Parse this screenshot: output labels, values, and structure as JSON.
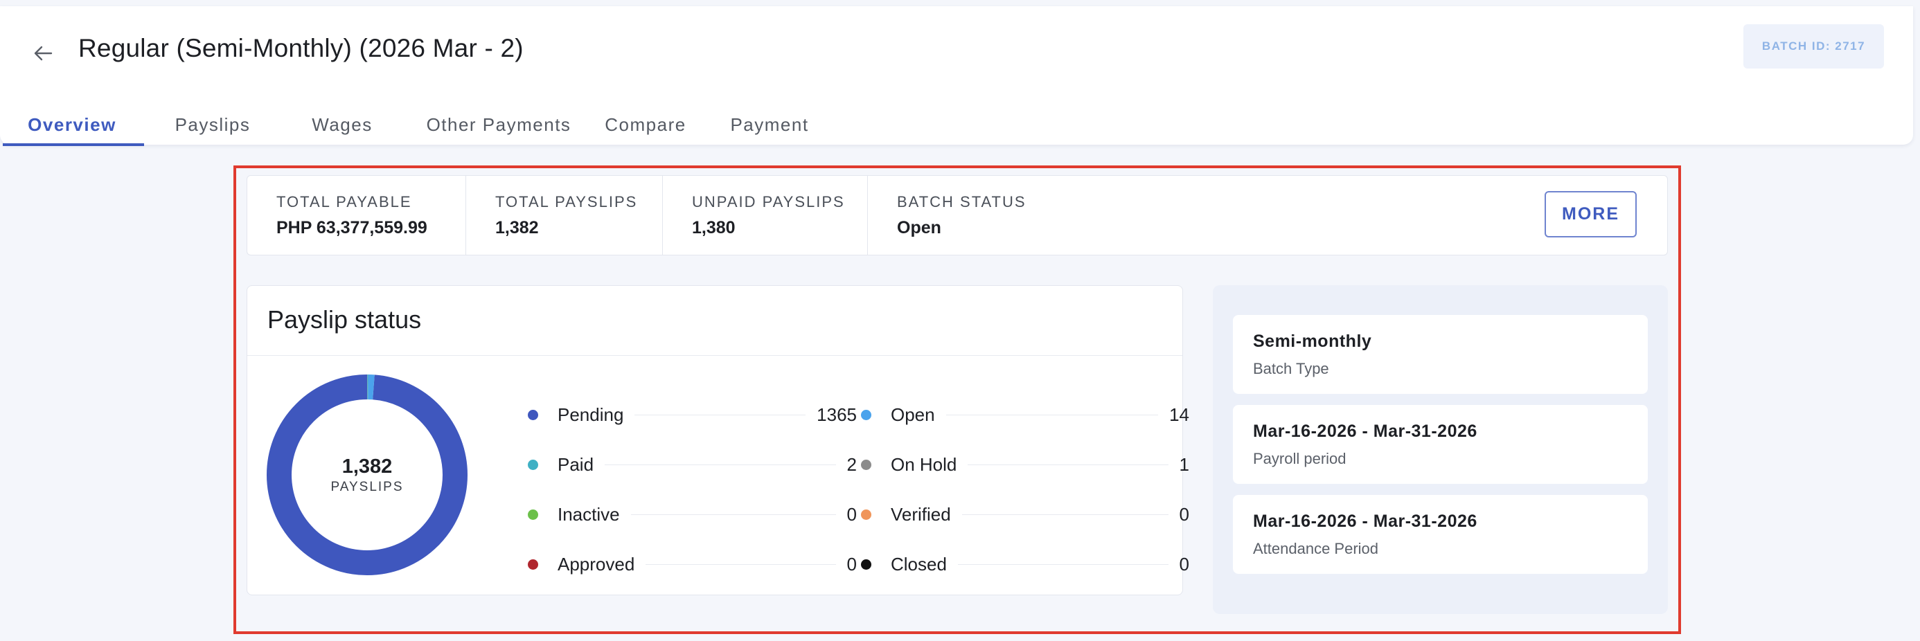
{
  "header": {
    "title": "Regular (Semi-Monthly) (2026 Mar - 2)",
    "batch_id": "BATCH ID: 2717",
    "back_icon": "arrow-left-icon"
  },
  "tabs": [
    {
      "label": "Overview",
      "active": true
    },
    {
      "label": "Payslips",
      "active": false
    },
    {
      "label": "Wages",
      "active": false
    },
    {
      "label": "Other Payments",
      "active": false
    },
    {
      "label": "Compare",
      "active": false
    },
    {
      "label": "Payment",
      "active": false
    }
  ],
  "summary": {
    "items": [
      {
        "label": "TOTAL PAYABLE",
        "value": "PHP 63,377,559.99"
      },
      {
        "label": "TOTAL PAYSLIPS",
        "value": "1,382"
      },
      {
        "label": "UNPAID PAYSLIPS",
        "value": "1,380"
      },
      {
        "label": "BATCH STATUS",
        "value": "Open"
      }
    ],
    "more_label": "MORE"
  },
  "payslip_status": {
    "title": "Payslip status",
    "center_count": "1,382",
    "center_label": "PAYSLIPS",
    "legend_left": [
      {
        "name": "Pending",
        "count": "1365",
        "color": "#3f57be"
      },
      {
        "name": "Paid",
        "count": "2",
        "color": "#3fb0c4"
      },
      {
        "name": "Inactive",
        "count": "0",
        "color": "#6cc04a"
      },
      {
        "name": "Approved",
        "count": "0",
        "color": "#b0262e"
      }
    ],
    "legend_right": [
      {
        "name": "Open",
        "count": "14",
        "color": "#4ba3ec"
      },
      {
        "name": "On Hold",
        "count": "1",
        "color": "#8c8c8c"
      },
      {
        "name": "Verified",
        "count": "0",
        "color": "#f0955a"
      },
      {
        "name": "Closed",
        "count": "0",
        "color": "#111111"
      }
    ]
  },
  "chart_data": {
    "type": "pie",
    "categories": [
      "Pending",
      "Open",
      "Paid",
      "On Hold",
      "Inactive",
      "Verified",
      "Approved",
      "Closed"
    ],
    "values": [
      1365,
      14,
      2,
      1,
      0,
      0,
      0,
      0
    ],
    "colors": [
      "#3f57be",
      "#4ba3ec",
      "#3fb0c4",
      "#8c8c8c",
      "#6cc04a",
      "#f0955a",
      "#b0262e",
      "#111111"
    ],
    "title": "Payslip status"
  },
  "batch_info": [
    {
      "value": "Semi-monthly",
      "label": "Batch Type"
    },
    {
      "value": "Mar-16-2026 - Mar-31-2026",
      "label": "Payroll period"
    },
    {
      "value": "Mar-16-2026 - Mar-31-2026",
      "label": "Attendance Period"
    }
  ],
  "colors": {
    "accent": "#3f5bbf",
    "highlight": "#e03b2f"
  }
}
